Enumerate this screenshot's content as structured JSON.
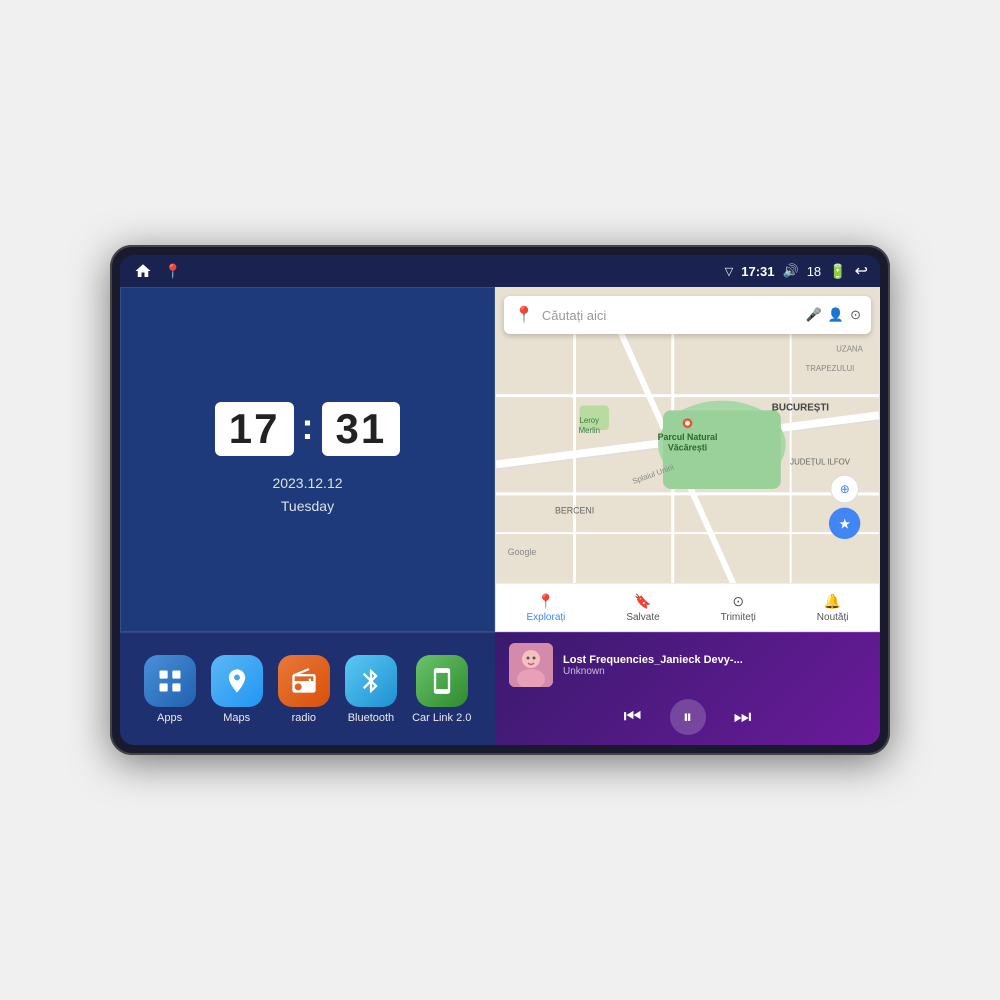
{
  "device": {
    "screen_bg": "#1e2a5e"
  },
  "status_bar": {
    "time": "17:31",
    "signal_icon": "▽",
    "volume_icon": "🔊",
    "battery_level": "18",
    "back_icon": "↩"
  },
  "clock": {
    "hour": "17",
    "minute": "31",
    "date": "2023.12.12",
    "day": "Tuesday"
  },
  "map": {
    "search_placeholder": "Căutați aici",
    "labels": {
      "explorati": "Explorați",
      "salvate": "Salvate",
      "trimiteti": "Trimiteți",
      "noutati": "Noutăți"
    },
    "places": [
      "Parcul Natural Văcărești",
      "Leroy Merlin",
      "BUCUREȘTI",
      "JUDEȚUL ILFOV",
      "BERCENI",
      "TRAPEZULUI",
      "UZANA",
      "Google"
    ],
    "road": "Splaiul Unirii"
  },
  "apps": [
    {
      "id": "apps",
      "label": "Apps",
      "icon_class": "icon-apps",
      "icon": "⊞"
    },
    {
      "id": "maps",
      "label": "Maps",
      "icon_class": "icon-maps",
      "icon": "📍"
    },
    {
      "id": "radio",
      "label": "radio",
      "icon_class": "icon-radio",
      "icon": "📻"
    },
    {
      "id": "bluetooth",
      "label": "Bluetooth",
      "icon_class": "icon-bluetooth",
      "icon": "⬡"
    },
    {
      "id": "carlink",
      "label": "Car Link 2.0",
      "icon_class": "icon-carlink",
      "icon": "📱"
    }
  ],
  "music": {
    "title": "Lost Frequencies_Janieck Devy-...",
    "artist": "Unknown",
    "prev_label": "⏮",
    "play_label": "⏸",
    "next_label": "⏭"
  }
}
